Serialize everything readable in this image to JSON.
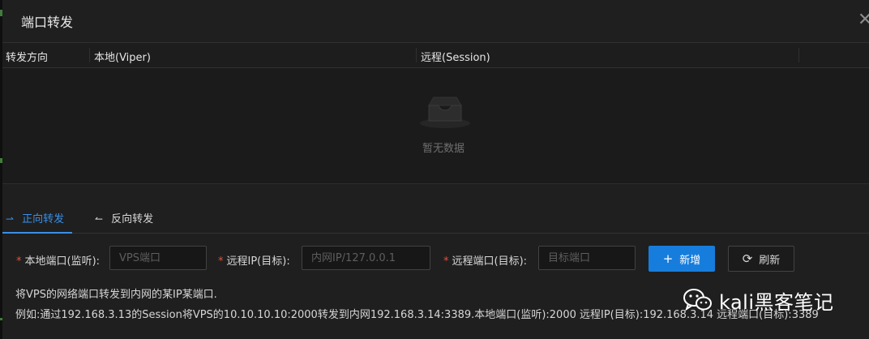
{
  "modal": {
    "title": "端口转发",
    "close_glyph": "✕"
  },
  "table": {
    "columns": [
      "转发方向",
      "本地(Viper)",
      "远程(Session)"
    ],
    "empty_text": "暂无数据"
  },
  "tabs": [
    {
      "label": "正向转发",
      "icon": "arrow-right-icon",
      "glyph": "⇀",
      "active": true
    },
    {
      "label": "反向转发",
      "icon": "arrow-left-icon",
      "glyph": "↼",
      "active": false
    }
  ],
  "form": {
    "required_mark": "*",
    "local_port": {
      "label": "本地端口(监听):",
      "placeholder": "VPS端口",
      "value": ""
    },
    "remote_ip": {
      "label": "远程IP(目标):",
      "placeholder": "内网IP/127.0.0.1",
      "value": ""
    },
    "remote_port": {
      "label": "远程端口(目标):",
      "placeholder": "目标端口",
      "value": ""
    },
    "add_button": {
      "label": "新增",
      "icon": "plus-icon",
      "glyph": "+"
    },
    "refresh_button": {
      "label": "刷新",
      "icon": "refresh-icon",
      "glyph": "⟳"
    }
  },
  "description": {
    "line1": "将VPS的网络端口转发到内网的某IP某端口.",
    "line2": "例如:通过192.168.3.13的Session将VPS的10.10.10.10:2000转发到内网192.168.3.14:3389.本地端口(监听):2000 远程IP(目标):192.168.3.14 远程端口(目标):3389"
  },
  "watermark": {
    "text": "kali黑客笔记",
    "icon": "wechat-icon"
  },
  "colors": {
    "accent": "#177ddc",
    "tab_active": "#3a8ee6",
    "required": "#e0533c",
    "background": "#1f1f1f"
  }
}
